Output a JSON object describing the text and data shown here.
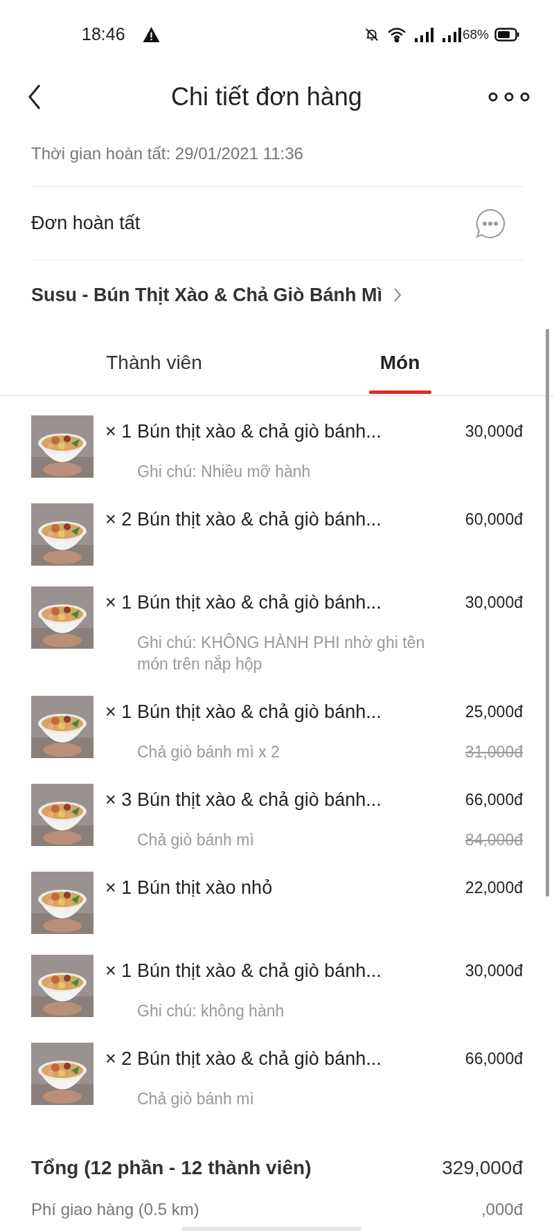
{
  "status_bar": {
    "time": "18:46",
    "battery": "68%"
  },
  "header": {
    "title": "Chi tiết đơn hàng"
  },
  "completed_time": "Thời gian hoàn tất: 29/01/2021 11:36",
  "status": {
    "label": "Đơn hoàn tất"
  },
  "restaurant": {
    "name": "Susu - Bún Thịt Xào & Chả Giò Bánh Mì"
  },
  "tabs": [
    {
      "label": "Thành viên",
      "selected": false
    },
    {
      "label": "Món",
      "selected": true
    }
  ],
  "items": [
    {
      "quantity": "× 1",
      "name": "Bún thịt xào & chả giò bánh...",
      "price": "30,000đ",
      "note": "Ghi chú: Nhiều mỡ hành"
    },
    {
      "quantity": "× 2",
      "name": "Bún thịt xào & chả giò bánh...",
      "price": "60,000đ"
    },
    {
      "quantity": "× 1",
      "name": "Bún thịt xào & chả giò bánh...",
      "price": "30,000đ",
      "note": "Ghi chú: KHÔNG HÀNH PHI nhờ ghi tên món trên nắp hộp"
    },
    {
      "quantity": "× 1",
      "name": "Bún thịt xào & chả giò bánh...",
      "price": "25,000đ",
      "note": "Chả giò bánh mì x 2",
      "original_price": "31,000đ"
    },
    {
      "quantity": "× 3",
      "name": "Bún thịt xào & chả giò bánh...",
      "price": "66,000đ",
      "note": "Chả giò bánh mì",
      "original_price": "84,000đ"
    },
    {
      "quantity": "× 1",
      "name": "Bún thịt xào nhỏ",
      "price": "22,000đ"
    },
    {
      "quantity": "× 1",
      "name": "Bún thịt xào & chả giò bánh...",
      "price": "30,000đ",
      "note": "Ghi chú: không hành"
    },
    {
      "quantity": "× 2",
      "name": "Bún thịt xào & chả giò bánh...",
      "price": "66,000đ",
      "note": "Chả giò bánh mì"
    }
  ],
  "summary": {
    "total_label": "Tổng (12 phần - 12 thành viên)",
    "total": "329,000đ",
    "fee_label": "Phí giao hàng (0.5 km)",
    "fee": ",000đ"
  }
}
